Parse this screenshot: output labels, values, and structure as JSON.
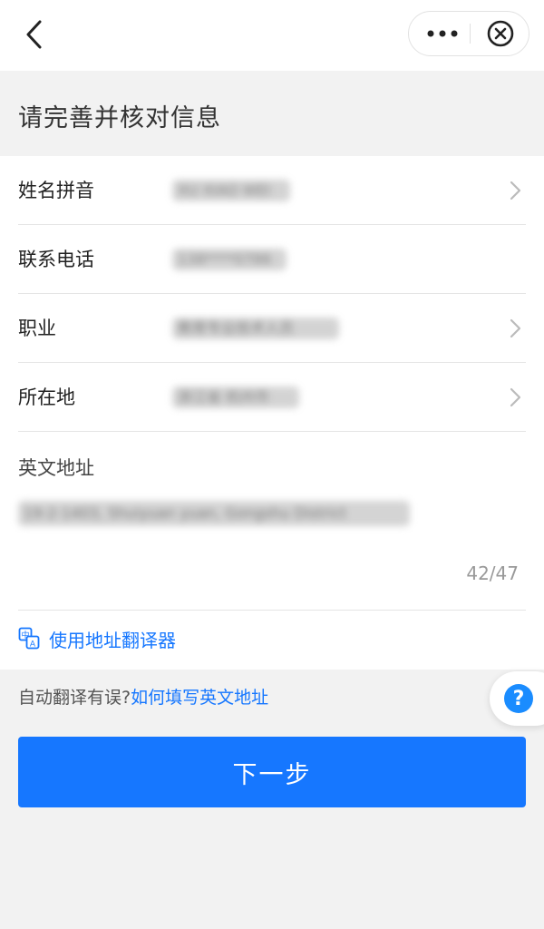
{
  "header": {
    "back_icon": "chevron-left-icon",
    "more_icon": "more-dots-icon",
    "close_icon": "close-circle-icon"
  },
  "page": {
    "title": "请完善并核对信息"
  },
  "form": {
    "name_pinyin": {
      "label": "姓名拼音",
      "value": "XU XIAO WEI"
    },
    "phone": {
      "label": "联系电话",
      "value": "138****0786"
    },
    "occupation": {
      "label": "职业",
      "value": "教育专业技术人员"
    },
    "location": {
      "label": "所在地",
      "value": "浙江省 杭州市"
    },
    "english_address": {
      "label": "英文地址",
      "value": "19-2-1403, Shuiyuan yuan, Gongshu District",
      "counter": "42/47"
    },
    "translator_link": "使用地址翻译器"
  },
  "hint": {
    "prefix": "自动翻译有误?",
    "link": "如何填写英文地址"
  },
  "actions": {
    "next_label": "下一步",
    "help_symbol": "?"
  },
  "colors": {
    "accent": "#1677ff",
    "background": "#f2f2f2",
    "help": "#1a8cff"
  }
}
